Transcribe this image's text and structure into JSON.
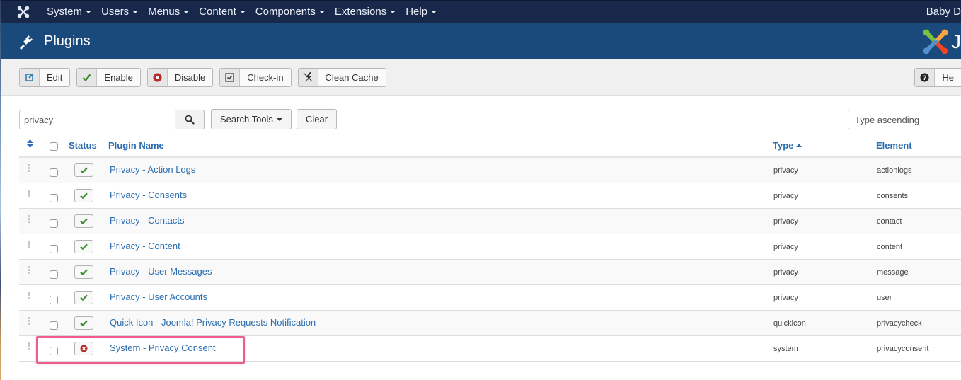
{
  "navbar": {
    "logo_icon": "joomla-icon",
    "menus": [
      {
        "label": "System"
      },
      {
        "label": "Users"
      },
      {
        "label": "Menus"
      },
      {
        "label": "Content"
      },
      {
        "label": "Components"
      },
      {
        "label": "Extensions"
      },
      {
        "label": "Help"
      }
    ],
    "user_label": "Baby D"
  },
  "titlebar": {
    "icon": "plug-icon",
    "title": "Plugins",
    "brand_letter": "J"
  },
  "toolbar": {
    "buttons": [
      {
        "label": "Edit",
        "icon": "edit-icon"
      },
      {
        "label": "Enable",
        "icon": "check-icon"
      },
      {
        "label": "Disable",
        "icon": "times-circle-icon"
      },
      {
        "label": "Check-in",
        "icon": "checkbox-icon"
      },
      {
        "label": "Clean Cache",
        "icon": "lightning-icon"
      }
    ],
    "help_label": "He"
  },
  "filters": {
    "search_value": "privacy",
    "search_placeholder": "",
    "search_tools_label": "Search Tools",
    "clear_label": "Clear",
    "sort_selected": "Type ascending"
  },
  "table": {
    "columns": {
      "status": "Status",
      "plugin_name": "Plugin Name",
      "type": "Type",
      "element": "Element"
    },
    "rows": [
      {
        "name": "Privacy - Action Logs",
        "type": "privacy",
        "element": "actionlogs",
        "enabled": true
      },
      {
        "name": "Privacy - Consents",
        "type": "privacy",
        "element": "consents",
        "enabled": true
      },
      {
        "name": "Privacy - Contacts",
        "type": "privacy",
        "element": "contact",
        "enabled": true
      },
      {
        "name": "Privacy - Content",
        "type": "privacy",
        "element": "content",
        "enabled": true
      },
      {
        "name": "Privacy - User Messages",
        "type": "privacy",
        "element": "message",
        "enabled": true
      },
      {
        "name": "Privacy - User Accounts",
        "type": "privacy",
        "element": "user",
        "enabled": true
      },
      {
        "name": "Quick Icon - Joomla! Privacy Requests Notification",
        "type": "quickicon",
        "element": "privacycheck",
        "enabled": true
      },
      {
        "name": "System - Privacy Consent",
        "type": "system",
        "element": "privacyconsent",
        "enabled": false
      }
    ]
  },
  "colors": {
    "navbar_bg": "#17284a",
    "titlebar_bg": "#1a4a7b",
    "link": "#2a6db0",
    "enabled_green": "#3a8a2e",
    "disabled_red": "#b52b27",
    "highlight": "#ef5b8e"
  }
}
